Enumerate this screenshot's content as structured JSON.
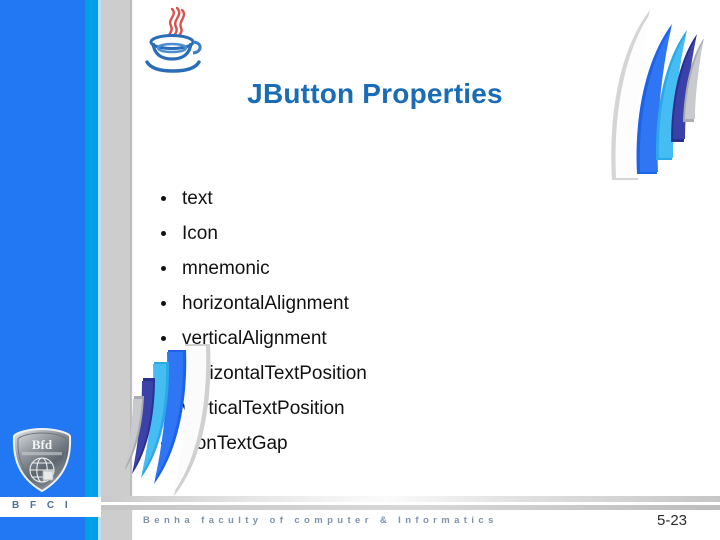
{
  "slide": {
    "title": "JButton Properties",
    "title_color": "#1a6cb5",
    "page_number": "5-23"
  },
  "sidebar": {
    "band_blue_color": "#2277f2",
    "band_cyan_color": "#00a0e9",
    "band_gray_color": "#cdcdcd",
    "logo_label": "Bfd",
    "logo_subtitle": "Benha Faculty of Computer & Informatics",
    "abbreviation": "B F C I"
  },
  "brand": {
    "java_logo_name": "java-coffee-cup-logo"
  },
  "content": {
    "bullets": [
      {
        "label": "text"
      },
      {
        "label": "Icon"
      },
      {
        "label": "mnemonic"
      },
      {
        "label": "horizontalAlignment"
      },
      {
        "label": "verticalAlignment"
      },
      {
        "label": "horizontalTextPosition"
      },
      {
        "label": "verticalTextPosition"
      },
      {
        "label": "iconTextGap"
      }
    ]
  },
  "footer": {
    "credit": "Benha faculty of computer & Informatics",
    "credit_color": "#7e93ab"
  },
  "decor": {
    "swoosh_blade_colors": [
      "#d9dadc",
      "#ffffff",
      "#1e62e8",
      "#2ba8e8",
      "#2b2f8f",
      "#a8aaae"
    ]
  }
}
